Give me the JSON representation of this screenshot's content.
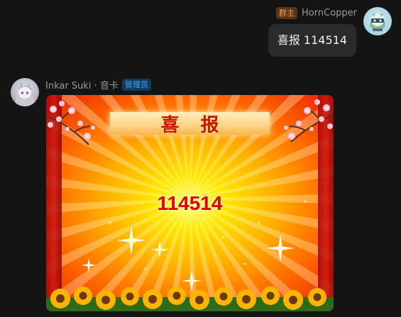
{
  "outgoing": {
    "role_badge": "群主",
    "sender_name": "HornCopper",
    "message": "喜报 114514"
  },
  "incoming": {
    "sender_name": "Inkar Suki · 音卡",
    "role_badge": "管理员",
    "card": {
      "banner_text": "喜报",
      "number": "114514"
    }
  },
  "colors": {
    "background": "#141414",
    "bubble": "#2a2a2a",
    "owner_badge_bg": "#5a3418",
    "owner_badge_fg": "#f0a055",
    "admin_badge_bg": "#123a5c",
    "admin_badge_fg": "#45a6f0",
    "card_number": "#e00000"
  }
}
